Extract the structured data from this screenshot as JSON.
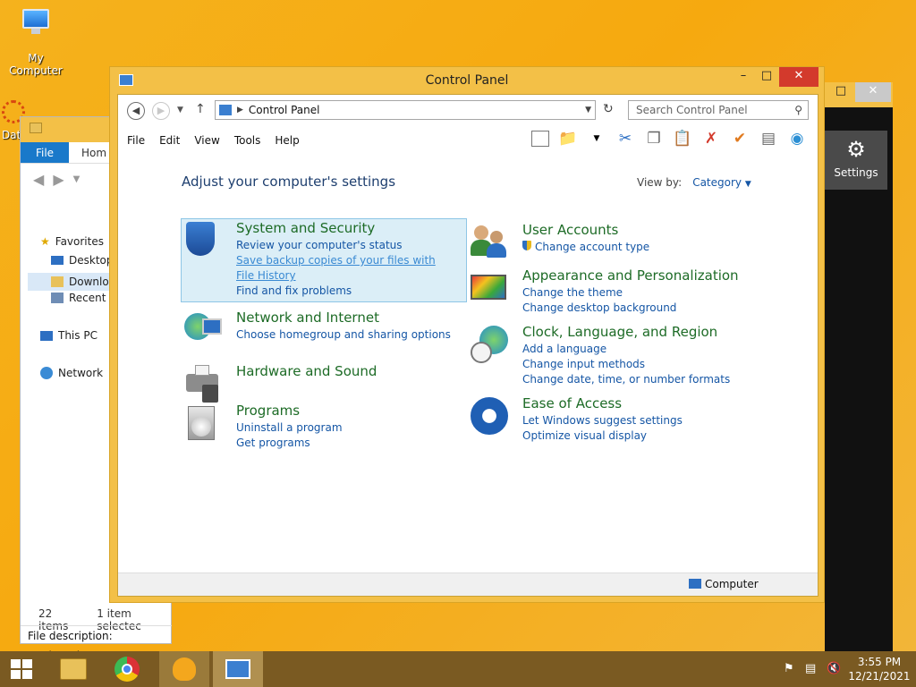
{
  "desktop": {
    "my_computer_label": "My Computer",
    "data_label": "Dat"
  },
  "explorer": {
    "file_tab": "File",
    "home_tab": "Hom",
    "nav": [
      "Favorites",
      "Desktop",
      "Downlo",
      "Recent p",
      "This PC",
      "Network"
    ],
    "status_items": "22 items",
    "status_selected": "1 item selectec",
    "file_description": "File description: DuckStation"
  },
  "darkapp": {
    "settings_label": "Settings"
  },
  "control_panel": {
    "title": "Control Panel",
    "address": "Control Panel",
    "search_placeholder": "Search Control Panel",
    "menu": [
      "File",
      "Edit",
      "View",
      "Tools",
      "Help"
    ],
    "heading": "Adjust your computer's settings",
    "view_by_label": "View by:",
    "view_by_value": "Category",
    "categories": [
      {
        "title": "System and Security",
        "links": [
          "Review your computer's status",
          "Save backup copies of your files with File History",
          "Find and fix problems"
        ]
      },
      {
        "title": "Network and Internet",
        "links": [
          "Choose homegroup and sharing options"
        ]
      },
      {
        "title": "Hardware and Sound",
        "links": []
      },
      {
        "title": "Programs",
        "links": [
          "Uninstall a program",
          "Get programs"
        ]
      },
      {
        "title": "User Accounts",
        "links": [
          "Change account type"
        ]
      },
      {
        "title": "Appearance and Personalization",
        "links": [
          "Change the theme",
          "Change desktop background"
        ]
      },
      {
        "title": "Clock, Language, and Region",
        "links": [
          "Add a language",
          "Change input methods",
          "Change date, time, or number formats"
        ]
      },
      {
        "title": "Ease of Access",
        "links": [
          "Let Windows suggest settings",
          "Optimize visual display"
        ]
      }
    ],
    "status_computer": "Computer"
  },
  "taskbar": {
    "time": "3:55 PM",
    "date": "12/21/2021"
  }
}
